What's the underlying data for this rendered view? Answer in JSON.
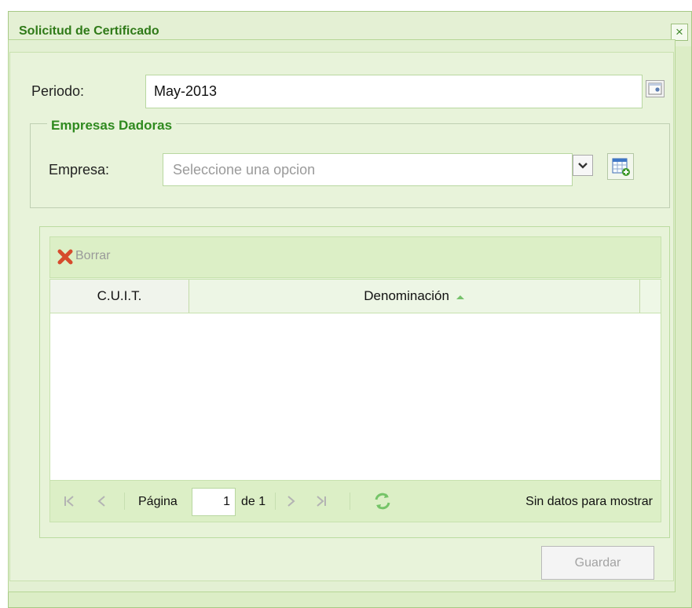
{
  "window": {
    "title": "Solicitud de Certificado",
    "close_glyph": "×"
  },
  "periodo": {
    "label": "Periodo:",
    "value": "May-2013",
    "trigger_icon": "calendar-icon"
  },
  "empresas_fieldset": {
    "legend": "Empresas Dadoras",
    "empresa_label": "Empresa:",
    "empresa_placeholder": "Seleccione una opcion",
    "combo_icon": "chevron-down-icon",
    "add_icon": "table-add-icon"
  },
  "grid": {
    "toolbar": {
      "delete_label": "Borrar",
      "delete_icon": "x-icon"
    },
    "columns": [
      {
        "label": "C.U.I.T."
      },
      {
        "label": "Denominación",
        "sort": "asc"
      }
    ],
    "rows": []
  },
  "pager": {
    "page_label": "Página",
    "page_value": "1",
    "of_label": "de 1",
    "empty_text": "Sin datos para mostrar",
    "refresh_icon": "refresh-icon"
  },
  "actions": {
    "save_label": "Guardar"
  },
  "colors": {
    "title_green": "#2f7a18",
    "legend_green": "#2f8a1f",
    "panel_bg": "#e8f3da",
    "header_bg": "#e4f0d4",
    "disabled_text": "#a3a3a3"
  }
}
